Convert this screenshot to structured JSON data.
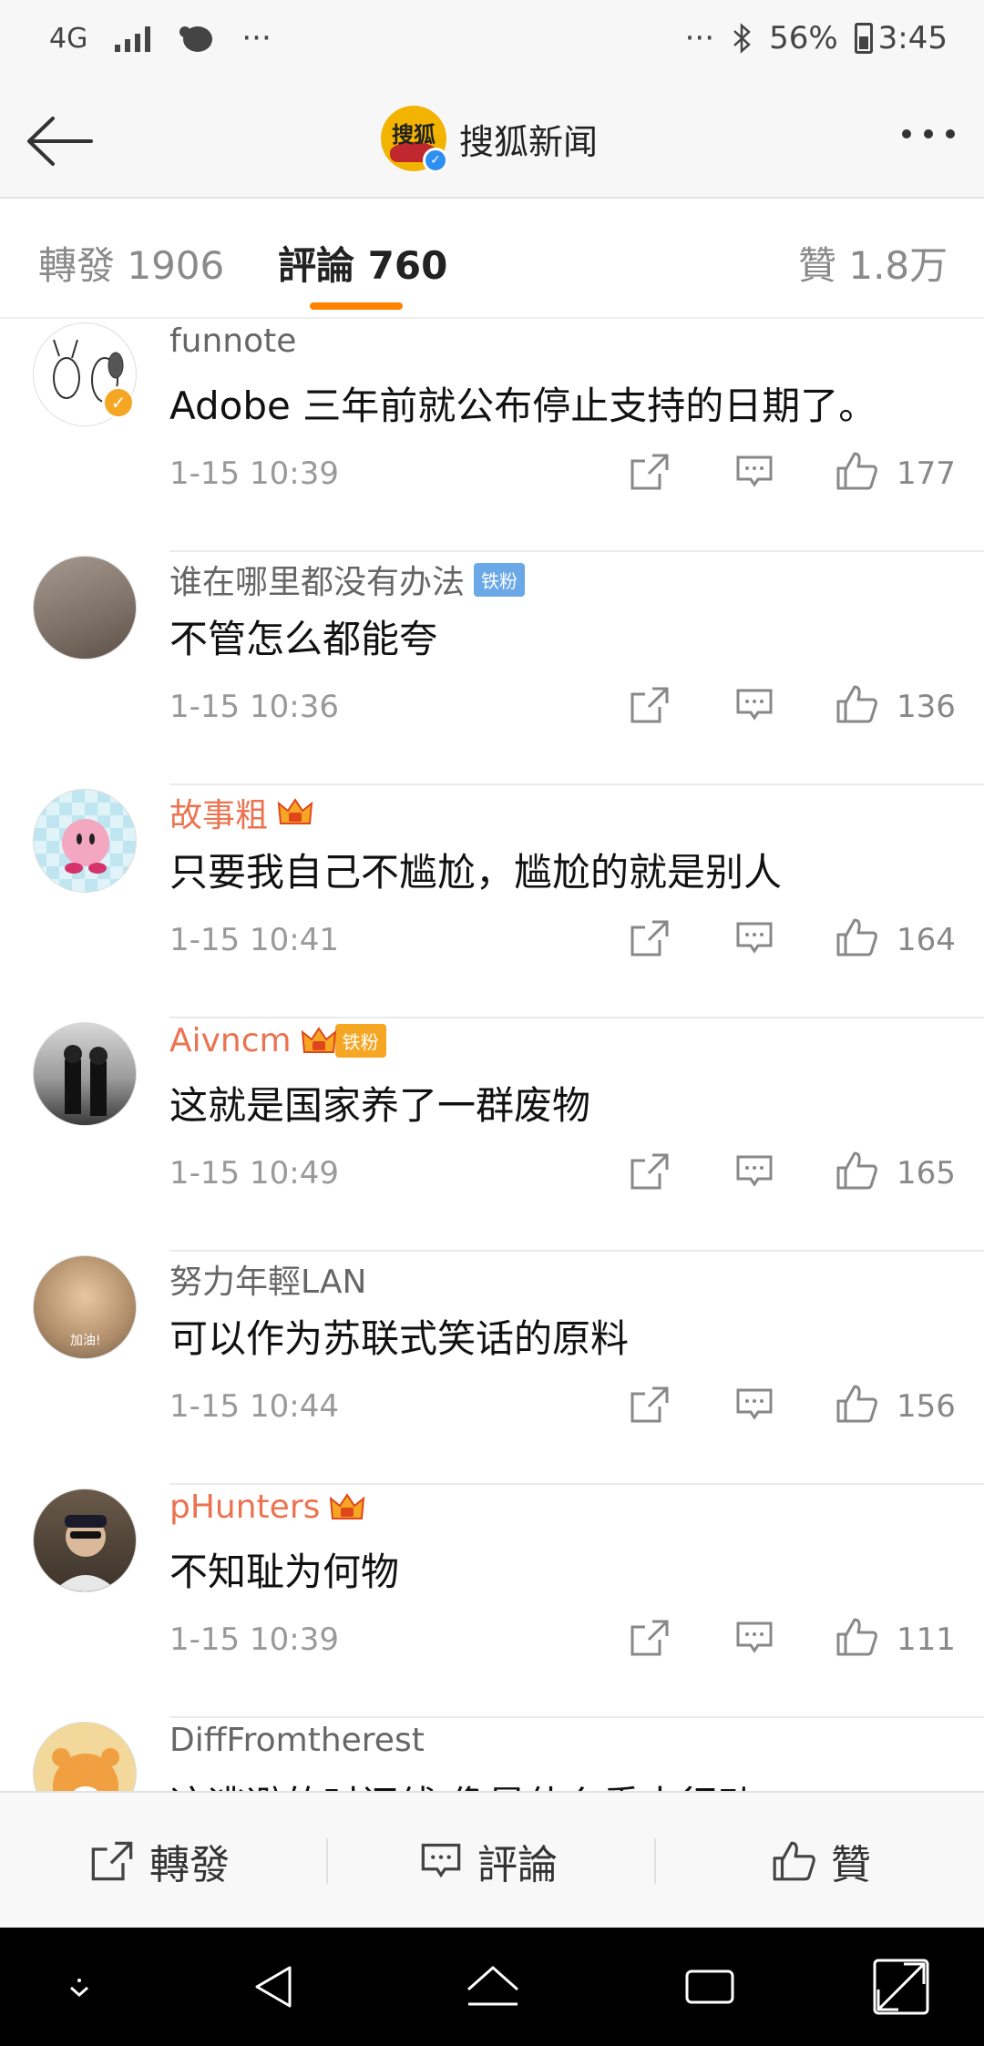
{
  "status_bar": {
    "network": "4G",
    "overflow_left": "···",
    "overflow_right": "···",
    "battery": "56%",
    "time": "3:45"
  },
  "header": {
    "title": "搜狐新闻",
    "logo_text": "搜狐"
  },
  "tabs": [
    {
      "label": "轉發 1906"
    },
    {
      "label": "評論 760"
    },
    {
      "label": "贊 1.8万"
    }
  ],
  "comments": [
    {
      "user": "funnote",
      "text": "Adobe 三年前就公布停止支持的日期了。",
      "time": "1-15 10:39",
      "likes": "177"
    },
    {
      "user": "谁在哪里都没有办法",
      "badge": "铁粉",
      "text": "不管怎么都能夸",
      "time": "1-15 10:36",
      "likes": "136"
    },
    {
      "user": "故事粗",
      "text": "只要我自己不尴尬，尴尬的就是别人",
      "time": "1-15 10:41",
      "likes": "164"
    },
    {
      "user": "Aivncm",
      "badge": "铁粉",
      "text": "这就是国家养了一群废物",
      "time": "1-15 10:49",
      "likes": "165"
    },
    {
      "user": "努力年輕LAN",
      "avatar_text": "加油!",
      "text": "可以作为苏联式笑话的原料",
      "time": "1-15 10:44",
      "likes": "156"
    },
    {
      "user": "pHunters",
      "text": "不知耻为何物",
      "time": "1-15 10:39",
      "likes": "111"
    },
    {
      "user": "DiffFromtherest",
      "text": "这逃避的时间线 像是什么重大行动"
    }
  ],
  "bottom_bar": {
    "repost": "轉發",
    "comment": "評論",
    "like": "贊"
  },
  "colors": {
    "accent": "#ff8200",
    "vip_name": "#eb7350",
    "fan_badge": "#6aa8e8"
  }
}
